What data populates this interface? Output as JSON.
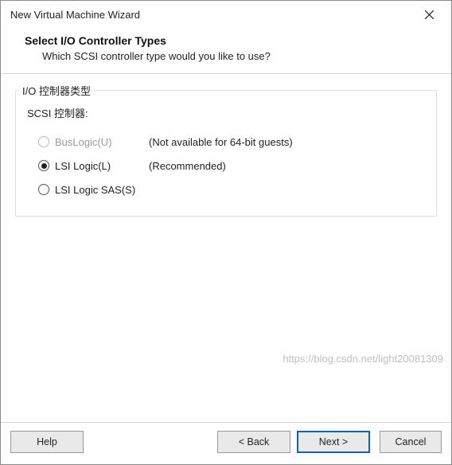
{
  "window": {
    "title": "New Virtual Machine Wizard"
  },
  "header": {
    "heading": "Select I/O Controller Types",
    "subheading": "Which SCSI controller type would you like to use?"
  },
  "group": {
    "legend": "I/O 控制器类型",
    "scsi_label": "SCSI 控制器:",
    "options": [
      {
        "label": "BusLogic(U)",
        "note": "(Not available for 64-bit guests)",
        "disabled": true,
        "checked": false
      },
      {
        "label": "LSI Logic(L)",
        "note": "(Recommended)",
        "disabled": false,
        "checked": true
      },
      {
        "label": "LSI Logic SAS(S)",
        "note": "",
        "disabled": false,
        "checked": false
      }
    ]
  },
  "buttons": {
    "help": "Help",
    "back": "< Back",
    "next": "Next >",
    "cancel": "Cancel"
  },
  "watermark": "https://blog.csdn.net/light20081309"
}
